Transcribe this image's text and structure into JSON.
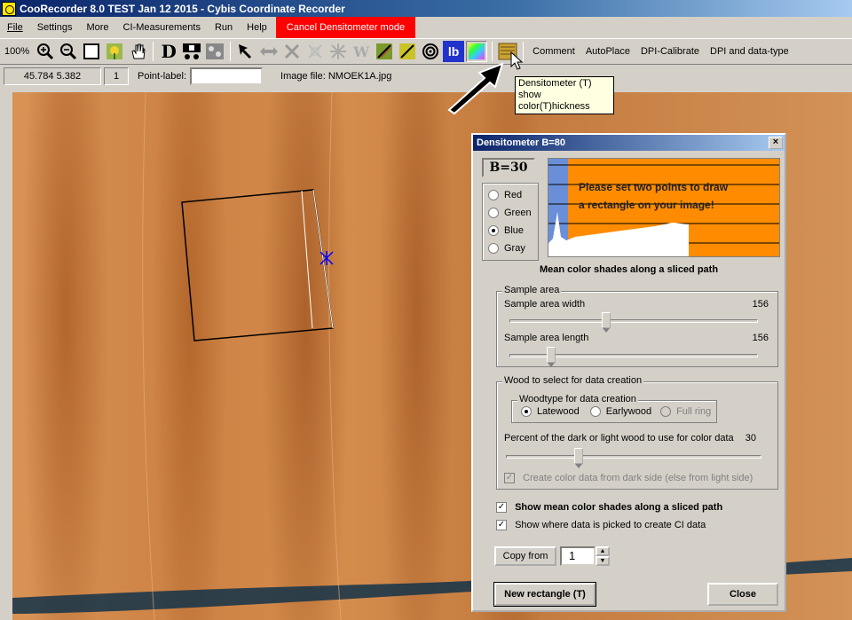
{
  "window": {
    "title": "CooRecorder 8.0 TEST Jan 12 2015 - Cybis Coordinate Recorder"
  },
  "menu": {
    "items": [
      "File",
      "Settings",
      "More",
      "CI-Measurements",
      "Run",
      "Help"
    ],
    "cancel_mode": "Cancel Densitometer mode"
  },
  "toolbar": {
    "zoom_label": "100%",
    "text_buttons": [
      "Comment",
      "AutoPlace",
      "DPI-Calibrate",
      "DPI and data-type"
    ],
    "d_letter": "D",
    "w_letter": "W",
    "lb_label": "lb"
  },
  "status": {
    "coords": "45.784  5.382",
    "count": "1",
    "point_label": "Point-label:",
    "point_value": "",
    "image_file": "Image file: NMOEK1A.jpg"
  },
  "tooltip": {
    "line1": "Densitometer (T)",
    "line2": "show color(T)hickness"
  },
  "densitometer": {
    "title": "Densitometer  B=80",
    "b_value": "B=30",
    "channels": [
      {
        "label": "Red",
        "selected": false
      },
      {
        "label": "Green",
        "selected": false
      },
      {
        "label": "Blue",
        "selected": true
      },
      {
        "label": "Gray",
        "selected": false
      }
    ],
    "graph_message_line1": "Please set two points to draw",
    "graph_message_line2": "a rectangle on your image!",
    "graph_caption": "Mean color shades along a sliced path",
    "sample_area": {
      "label": "Sample area",
      "width_label": "Sample area width",
      "width_value": "156",
      "width_fraction": 0.43,
      "length_label": "Sample area length",
      "length_value": "156",
      "length_fraction": 0.18
    },
    "wood_select": {
      "label": "Wood to select for data creation",
      "woodtype_label": "Woodtype for data creation",
      "latewood": "Latewood",
      "earlywood": "Earlywood",
      "full_ring": "Full ring",
      "selected": "Latewood",
      "percent_label": "Percent of the dark or light wood to use for color data",
      "percent_value": "30",
      "percent_fraction": 0.3,
      "create_from_dark": "Create color data from dark side (else from light side)"
    },
    "show_mean": "Show mean color shades along a sliced path",
    "show_where": "Show where data is picked to create CI data",
    "copy_from_label": "Copy from",
    "copy_from_value": "1",
    "new_rect_label": "New rectangle (T)",
    "close_label": "Close"
  },
  "colors": {
    "graph_bg": "#ff8c00",
    "graph_blue": "#6a8fd8",
    "cancel_red": "#ff0000"
  }
}
